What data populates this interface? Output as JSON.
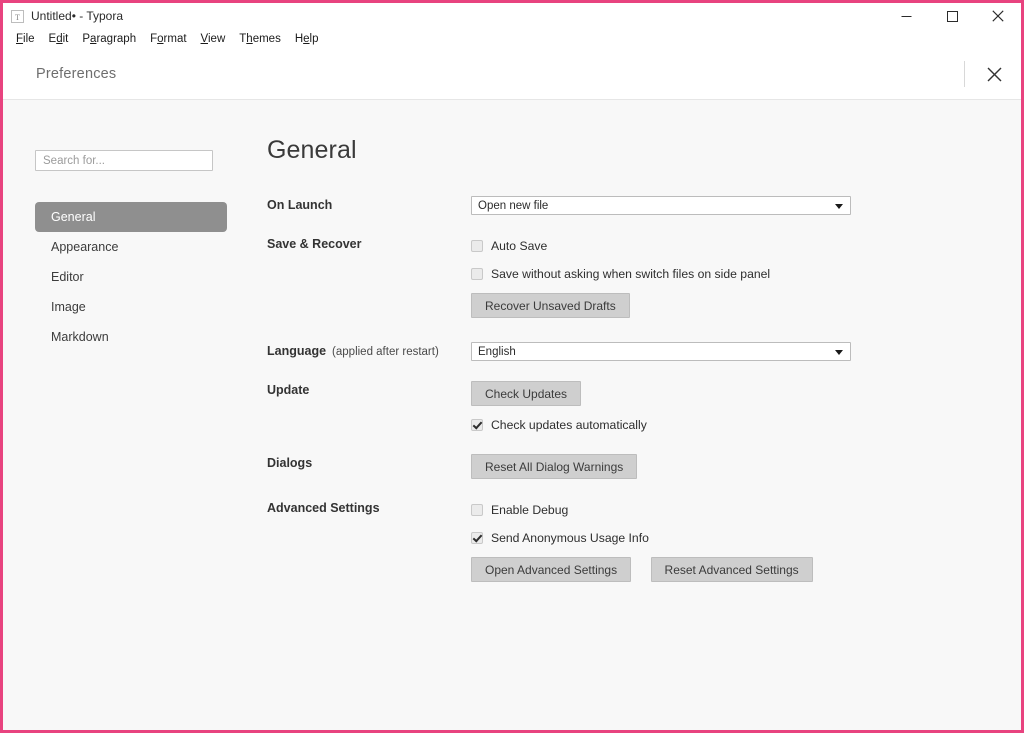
{
  "window": {
    "title": "Untitled• - Typora",
    "app_icon": "T",
    "controls": {
      "minimize": "minimize-icon",
      "maximize": "maximize-icon",
      "close": "close-icon"
    }
  },
  "menubar": {
    "items": [
      {
        "label": "File",
        "mnemonic_index": 0
      },
      {
        "label": "Edit",
        "mnemonic_index": 1
      },
      {
        "label": "Paragraph",
        "mnemonic_index": 1
      },
      {
        "label": "Format",
        "mnemonic_index": 1
      },
      {
        "label": "View",
        "mnemonic_index": 0
      },
      {
        "label": "Themes",
        "mnemonic_index": 1
      },
      {
        "label": "Help",
        "mnemonic_index": 1
      }
    ]
  },
  "preferences": {
    "header_title": "Preferences",
    "close_icon": "close-icon",
    "search": {
      "value": "",
      "placeholder": "Search for..."
    },
    "nav": {
      "items": [
        {
          "label": "General",
          "selected": true
        },
        {
          "label": "Appearance",
          "selected": false
        },
        {
          "label": "Editor",
          "selected": false
        },
        {
          "label": "Image",
          "selected": false
        },
        {
          "label": "Markdown",
          "selected": false
        }
      ]
    },
    "page": {
      "title": "General",
      "on_launch": {
        "label": "On Launch",
        "select_value": "Open new file",
        "caret_icon": "chevron-down-icon"
      },
      "save_recover": {
        "label": "Save & Recover",
        "auto_save": {
          "label": "Auto Save",
          "checked": false
        },
        "save_without_asking": {
          "label": "Save without asking when switch files on side panel",
          "checked": false
        },
        "recover_button": "Recover Unsaved Drafts"
      },
      "language": {
        "label": "Language",
        "note": "(applied after restart)",
        "select_value": "English",
        "caret_icon": "chevron-down-icon"
      },
      "update": {
        "label": "Update",
        "check_button": "Check Updates",
        "auto_check": {
          "label": "Check updates automatically",
          "checked": true
        }
      },
      "dialogs": {
        "label": "Dialogs",
        "reset_button": "Reset All Dialog Warnings"
      },
      "advanced": {
        "label": "Advanced Settings",
        "enable_debug": {
          "label": "Enable Debug",
          "checked": false
        },
        "send_usage": {
          "label": "Send Anonymous Usage Info",
          "checked": true
        },
        "open_button": "Open Advanced Settings",
        "reset_button": "Reset Advanced Settings"
      }
    }
  },
  "colors": {
    "window_border": "#e8437f",
    "nav_selected_bg": "#8f8f8f",
    "button_bg": "#cfcfcf",
    "body_bg": "#f8f8f8"
  }
}
